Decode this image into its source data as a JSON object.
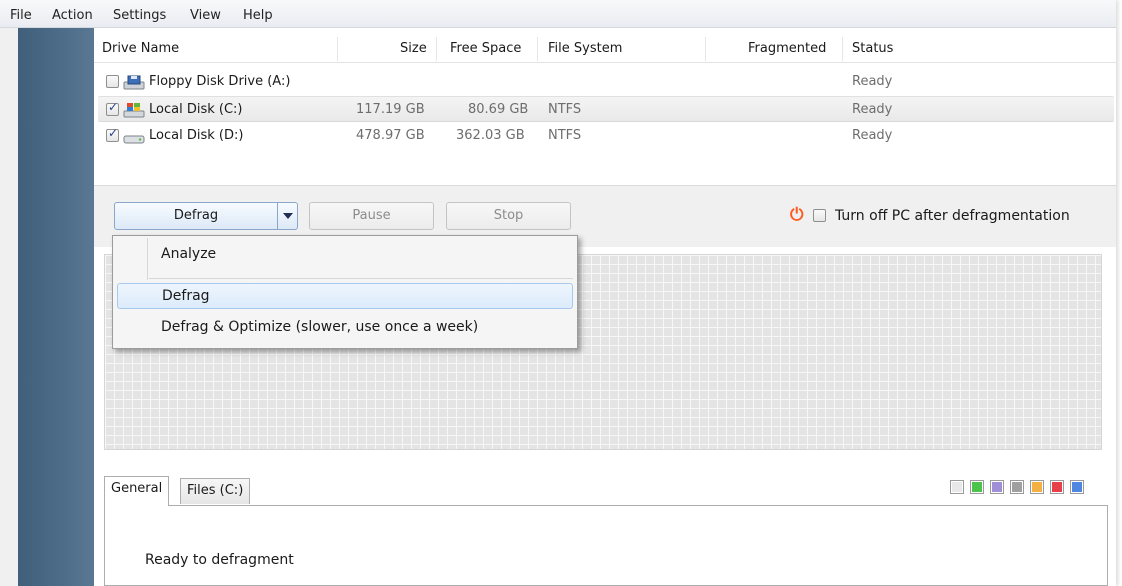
{
  "menubar": {
    "items": [
      "File",
      "Action",
      "Settings",
      "View",
      "Help"
    ]
  },
  "table": {
    "headers": [
      "Drive Name",
      "Size",
      "Free Space",
      "File System",
      "Fragmented",
      "Status"
    ],
    "rows": [
      {
        "name": "Floppy Disk Drive (A:)",
        "size": "",
        "free": "",
        "fs": "",
        "frag": "",
        "status": "Ready",
        "checked": false,
        "icon": "floppy-drive-icon"
      },
      {
        "name": "Local Disk (C:)",
        "size": "117.19 GB",
        "free": "80.69 GB",
        "fs": "NTFS",
        "frag": "",
        "status": "Ready",
        "checked": true,
        "icon": "system-disk-icon"
      },
      {
        "name": "Local Disk (D:)",
        "size": "478.97 GB",
        "free": "362.03 GB",
        "fs": "NTFS",
        "frag": "",
        "status": "Ready",
        "checked": true,
        "icon": "hard-disk-icon"
      }
    ]
  },
  "toolbar": {
    "defrag": "Defrag",
    "pause": "Pause",
    "stop": "Stop",
    "turn_off": "Turn off PC after defragmentation",
    "turn_off_checked": false
  },
  "dropdown": {
    "items": [
      "Analyze",
      "Defrag",
      "Defrag & Optimize (slower, use once a week)"
    ],
    "highlighted": "Defrag"
  },
  "tabs": {
    "general": "General",
    "files": "Files (C:)",
    "active": "General"
  },
  "status_text": "Ready to defragment",
  "legend_colors": [
    "#e8e8e8",
    "#4cc44c",
    "#9e8fd6",
    "#a0a0a0",
    "#f5b043",
    "#e8404a",
    "#4f86e0"
  ]
}
